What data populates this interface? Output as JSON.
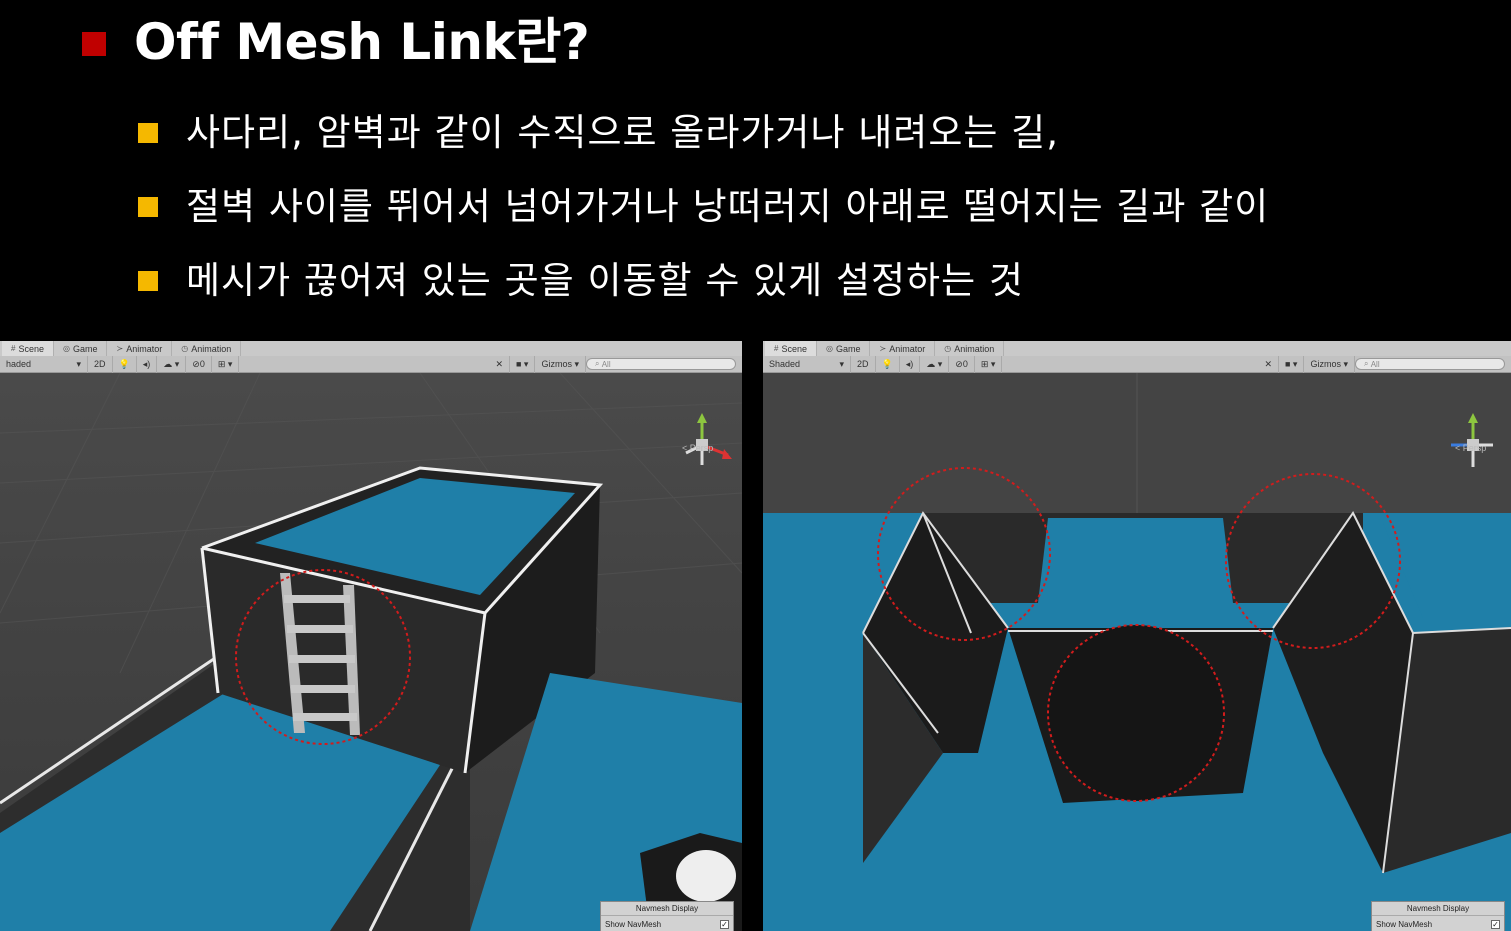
{
  "slide": {
    "title": "Off Mesh Link란?",
    "bullets": [
      "사다리, 암벽과 같이 수직으로 올라가거나 내려오는 길,",
      "절벽 사이를 뛰어서 넘어가거나 낭떠러지 아래로 떨어지는 길과 같이",
      "메시가 끊어져 있는 곳을 이동할 수 있게 설정하는 것"
    ],
    "colors": {
      "title_bullet": "#c00000",
      "sub_bullet": "#f5b800",
      "navmesh": "#1f7fa8"
    }
  },
  "left_editor": {
    "tabs": [
      "Scene",
      "Game",
      "Animator",
      "Animation"
    ],
    "shading_mode": "haded",
    "toolbar": {
      "mode_2d": "2D",
      "fx_count": "0",
      "gizmos_label": "Gizmos",
      "search_placeholder": "All"
    },
    "persp_label": "< Persp",
    "navmesh_panel": {
      "title": "Navmesh Display",
      "show_navmesh": "Show NavMesh",
      "checked": "✓"
    }
  },
  "right_editor": {
    "tabs": [
      "Scene",
      "Game",
      "Animator",
      "Animation"
    ],
    "shading_mode": "Shaded",
    "toolbar": {
      "mode_2d": "2D",
      "fx_count": "0",
      "gizmos_label": "Gizmos",
      "search_placeholder": "All"
    },
    "persp_label": "< Persp",
    "navmesh_panel": {
      "title": "Navmesh Display",
      "show_navmesh": "Show NavMesh",
      "checked": "✓"
    }
  }
}
